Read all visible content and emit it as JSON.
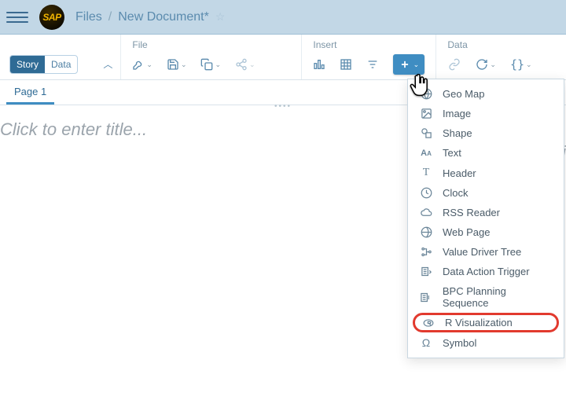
{
  "breadcrumb": {
    "root": "Files",
    "current": "New Document*"
  },
  "mode_toggle": {
    "story": "Story",
    "data": "Data"
  },
  "groups": {
    "file": "File",
    "insert": "Insert",
    "data": "Data"
  },
  "page_tab": "Page 1",
  "title_placeholder": "Click to enter title...",
  "menu": {
    "geo_map": "Geo Map",
    "image": "Image",
    "shape": "Shape",
    "text": "Text",
    "header": "Header",
    "clock": "Clock",
    "rss": "RSS Reader",
    "web": "Web Page",
    "vdt": "Value Driver Tree",
    "dat": "Data Action Trigger",
    "bpc": "BPC Planning Sequence",
    "rviz": "R Visualization",
    "symbol": "Symbol"
  }
}
